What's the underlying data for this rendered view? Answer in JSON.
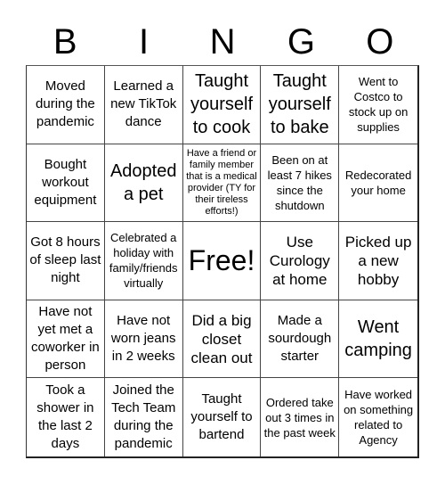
{
  "header": {
    "letters": [
      "B",
      "I",
      "N",
      "G",
      "O"
    ]
  },
  "cells": [
    "Moved during the pandemic",
    "Learned a new TikTok dance",
    "Taught yourself to cook",
    "Taught yourself to bake",
    "Went to Costco to stock up on supplies",
    "Bought workout equipment",
    "Adopted a pet",
    "Have a friend or family member that is a medical provider (TY for their tireless efforts!)",
    "Been on at least 7 hikes since the shutdown",
    "Redecorated your home",
    "Got 8 hours of sleep last night",
    "Celebrated a holiday with family/friends virtually",
    "Free!",
    "Use Curology at home",
    "Picked up a new hobby",
    "Have not yet met a coworker in person",
    "Have not worn jeans in 2 weeks",
    "Did a big closet clean out",
    "Made a sourdough starter",
    "Went camping",
    "Took a shower in the last 2 days",
    "Joined the Tech Team during the pandemic",
    "Taught yourself to bartend",
    "Ordered take out 3 times in the past week",
    "Have worked on something related to Agency"
  ]
}
